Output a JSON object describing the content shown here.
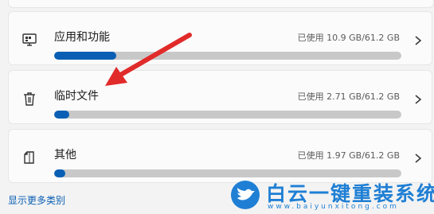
{
  "storage_items": [
    {
      "icon": "apps-icon",
      "label": "应用和功能",
      "usage": "已使用 10.9 GB/61.2 GB",
      "used_fraction": 0.178
    },
    {
      "icon": "trash-icon",
      "label": "临时文件",
      "usage": "已使用 2.71 GB/61.2 GB",
      "used_fraction": 0.044
    },
    {
      "icon": "other-file-icon",
      "label": "其他",
      "usage": "已使用 1.97 GB/61.2 GB",
      "used_fraction": 0.032
    }
  ],
  "more_link": "显示更多类别",
  "watermark": {
    "text": "白云一键重装系统",
    "url": "www.baiyunxitong.com"
  },
  "colors": {
    "accent": "#0a5fb4",
    "arrow": "#e12a2a",
    "watermark": "#1f7fd4"
  }
}
